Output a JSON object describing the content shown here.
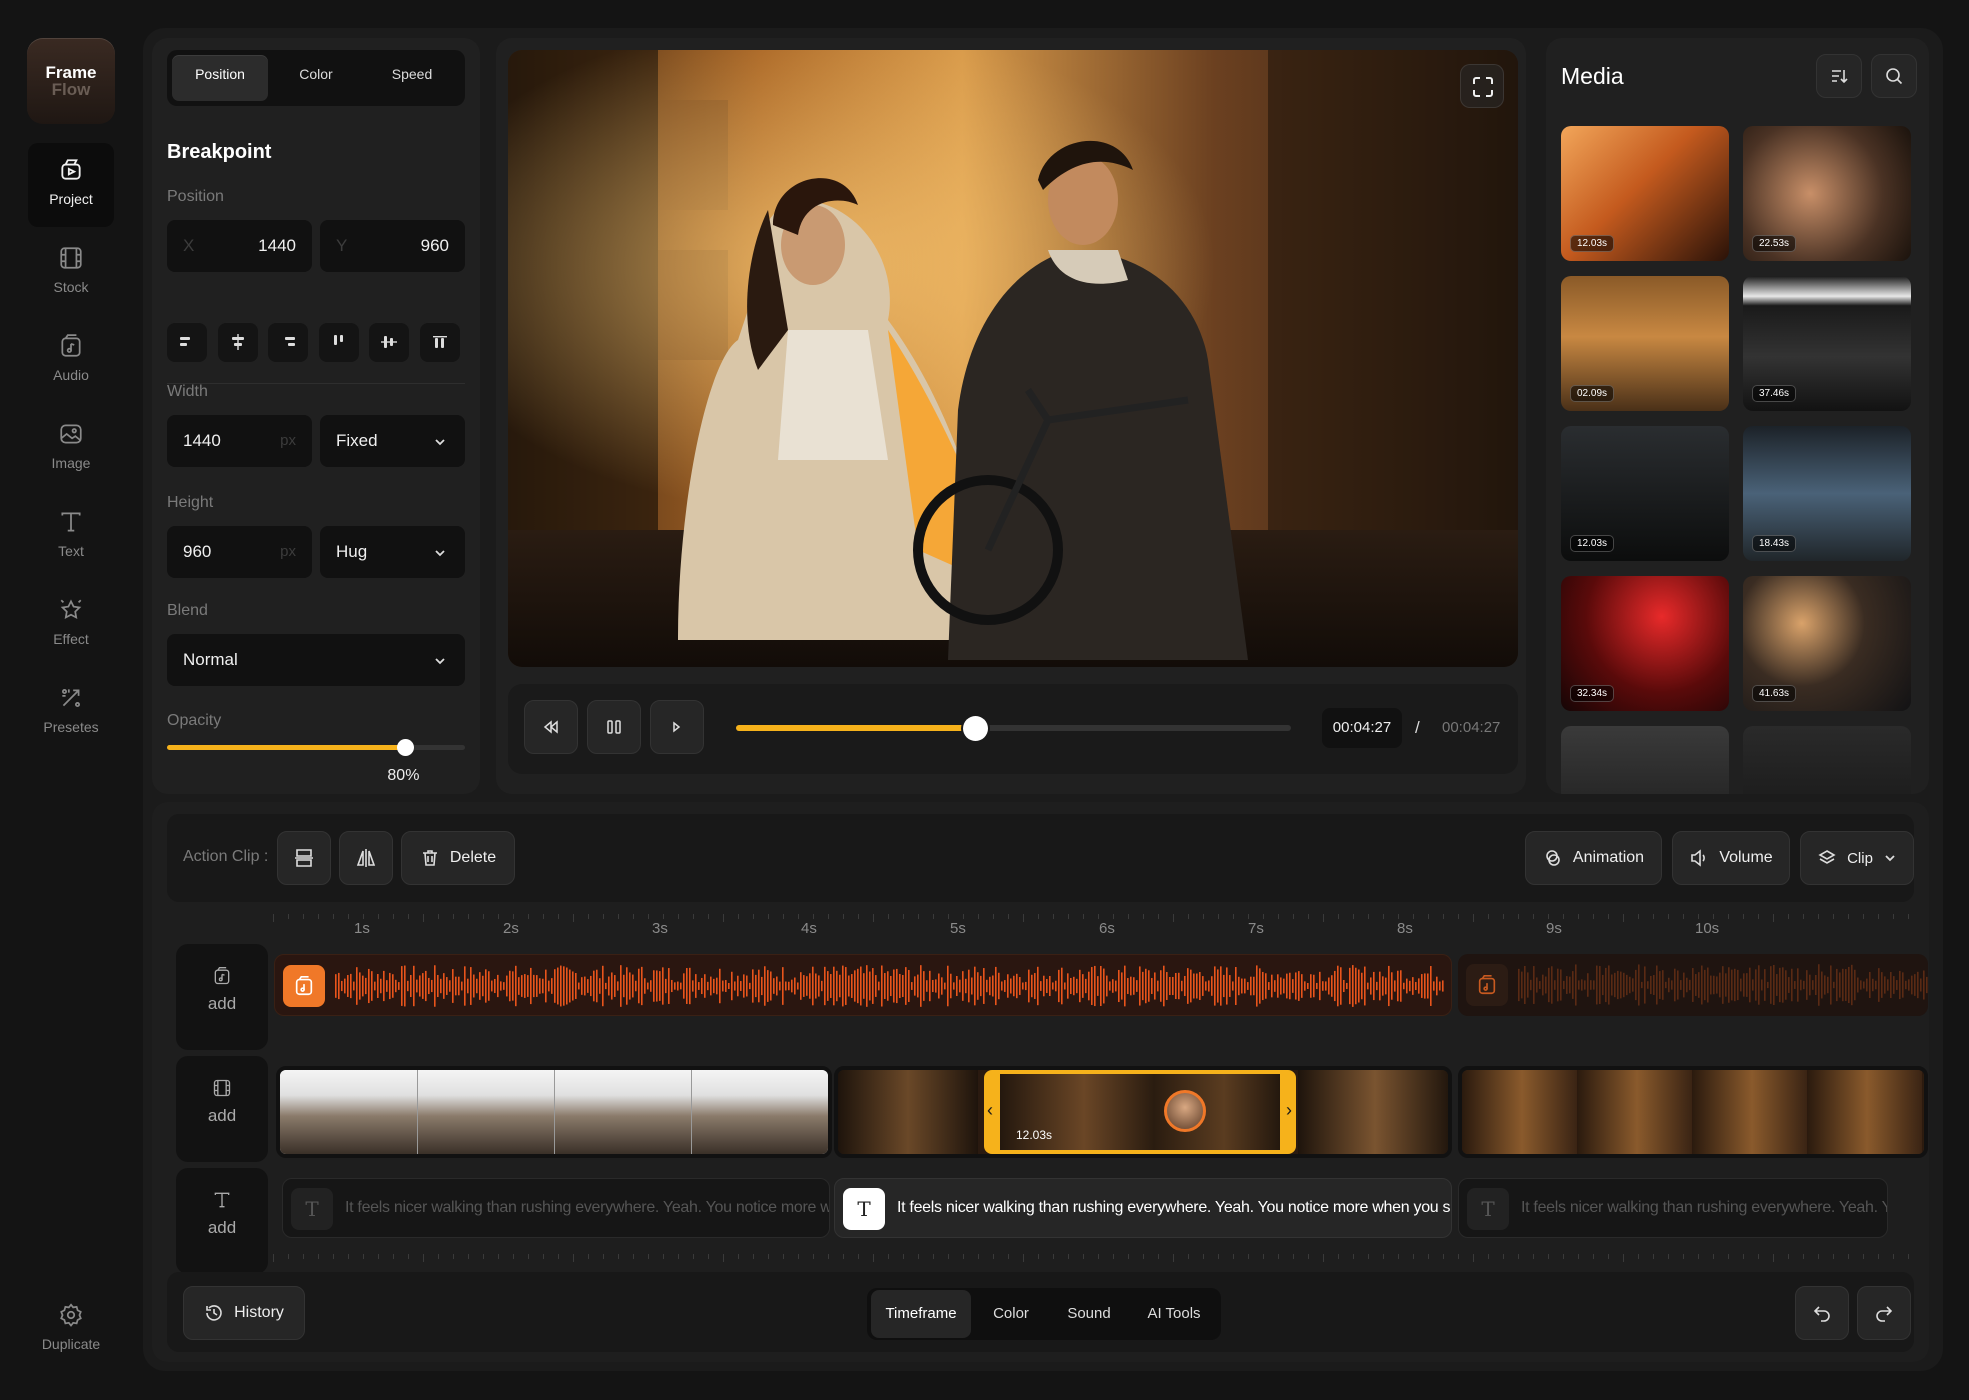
{
  "app": {
    "logo_line1": "Frame",
    "logo_line2": "Flow"
  },
  "sidebar": {
    "items": [
      {
        "label": "Project",
        "icon": "project-icon"
      },
      {
        "label": "Stock",
        "icon": "stock-icon"
      },
      {
        "label": "Audio",
        "icon": "audio-icon"
      },
      {
        "label": "Image",
        "icon": "image-icon"
      },
      {
        "label": "Text",
        "icon": "text-icon"
      },
      {
        "label": "Effect",
        "icon": "effect-icon"
      },
      {
        "label": "Presetes",
        "icon": "presets-icon"
      }
    ],
    "bottom": {
      "label": "Duplicate",
      "icon": "gear-icon"
    }
  },
  "properties": {
    "tabs": [
      "Position",
      "Color",
      "Speed"
    ],
    "section_title": "Breakpoint",
    "position_label": "Position",
    "x_hint": "X",
    "x_value": "1440",
    "y_hint": "Y",
    "y_value": "960",
    "width_label": "Width",
    "width_value": "1440",
    "width_unit": "px",
    "width_mode": "Fixed",
    "height_label": "Height",
    "height_value": "960",
    "height_unit": "px",
    "height_mode": "Hug",
    "blend_label": "Blend",
    "blend_value": "Normal",
    "opacity_label": "Opacity",
    "opacity_value": "80%",
    "opacity_fraction": 0.8
  },
  "player": {
    "current_time": "00:04:27",
    "separator": "/",
    "total_time": "00:04:27",
    "progress_fraction": 0.43,
    "accent": "#f6b21b"
  },
  "media": {
    "title": "Media",
    "items": [
      {
        "duration": "12.03s"
      },
      {
        "duration": "22.53s"
      },
      {
        "duration": "02.09s"
      },
      {
        "duration": "37.46s"
      },
      {
        "duration": "12.03s"
      },
      {
        "duration": "18.43s"
      },
      {
        "duration": "32.34s"
      },
      {
        "duration": "41.63s"
      }
    ]
  },
  "toolbar": {
    "action_label": "Action Clip :",
    "delete_label": "Delete",
    "animation_label": "Animation",
    "volume_label": "Volume",
    "clip_label": "Clip"
  },
  "timeline": {
    "ticks": [
      "1s",
      "2s",
      "3s",
      "4s",
      "5s",
      "6s",
      "7s",
      "8s",
      "9s",
      "10s"
    ],
    "track_add_label": "add",
    "selected_clip_duration": "12.03s",
    "captions": [
      "It feels nicer walking than rushing everywhere. Yeah. You notice more when you slow down.",
      "It feels nicer walking than rushing everywhere. Yeah. You notice more when you slow down.",
      "It feels nicer walking than rushing everywhere. Yeah. You notice more when you slow down."
    ]
  },
  "bottom_bar": {
    "history_label": "History",
    "tabs": [
      "Timeframe",
      "Color",
      "Sound",
      "AI Tools"
    ]
  }
}
